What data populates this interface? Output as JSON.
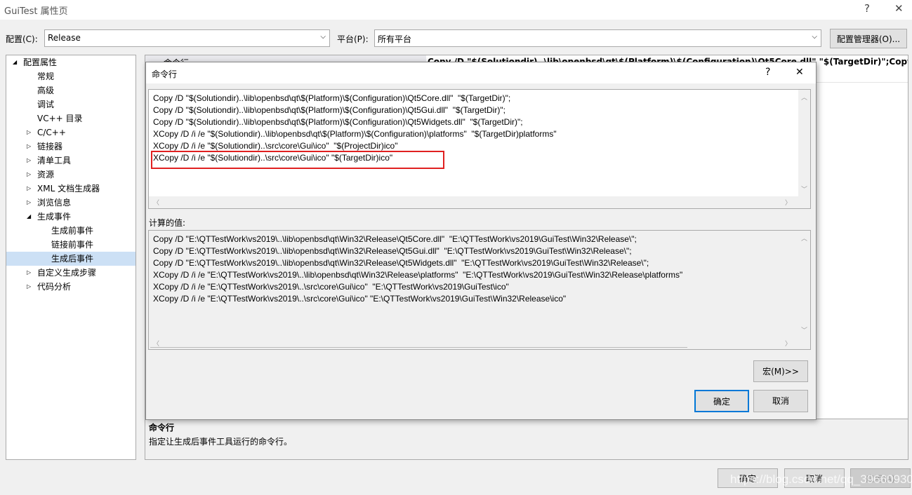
{
  "window": {
    "title": "GuiTest 属性页",
    "help": "?",
    "close": "✕"
  },
  "config": {
    "label": "配置(C):",
    "value": "Release",
    "platform_label": "平台(P):",
    "platform_value": "所有平台",
    "manager": "配置管理器(O)..."
  },
  "tree": [
    {
      "label": "配置属性",
      "level": 0,
      "expander": "◢"
    },
    {
      "label": "常规",
      "level": 1
    },
    {
      "label": "高级",
      "level": 1
    },
    {
      "label": "调试",
      "level": 1
    },
    {
      "label": "VC++ 目录",
      "level": 1
    },
    {
      "label": "C/C++",
      "level": 1,
      "expander": "▷"
    },
    {
      "label": "链接器",
      "level": 1,
      "expander": "▷"
    },
    {
      "label": "清单工具",
      "level": 1,
      "expander": "▷"
    },
    {
      "label": "资源",
      "level": 1,
      "expander": "▷"
    },
    {
      "label": "XML 文档生成器",
      "level": 1,
      "expander": "▷"
    },
    {
      "label": "浏览信息",
      "level": 1,
      "expander": "▷"
    },
    {
      "label": "生成事件",
      "level": 1,
      "expander": "◢"
    },
    {
      "label": "生成前事件",
      "level": 2
    },
    {
      "label": "链接前事件",
      "level": 2
    },
    {
      "label": "生成后事件",
      "level": 2,
      "selected": true
    },
    {
      "label": "自定义生成步骤",
      "level": 1,
      "expander": "▷"
    },
    {
      "label": "代码分析",
      "level": 1,
      "expander": "▷"
    }
  ],
  "property": {
    "name": "命令行",
    "value": "Copy /D \"$(Solutiondir)..\\lib\\openbsd\\qt\\$(Platform)\\$(Configuration)\\Qt5Core.dll\"  \"$(TargetDir)\";Copy /D \"$"
  },
  "description": {
    "title": "命令行",
    "text": "指定让生成后事件工具运行的命令行。"
  },
  "buttons": {
    "ok": "确定",
    "cancel": "取消",
    "apply": "应用(A)"
  },
  "watermark": "https://blog.csdn.net/qq_39660930",
  "dialog": {
    "title": "命令行",
    "help": "?",
    "close": "✕",
    "commands": [
      "Copy /D \"$(Solutiondir)..\\lib\\openbsd\\qt\\$(Platform)\\$(Configuration)\\Qt5Core.dll\"  \"$(TargetDir)\";",
      "Copy /D \"$(Solutiondir)..\\lib\\openbsd\\qt\\$(Platform)\\$(Configuration)\\Qt5Gui.dll\"  \"$(TargetDir)\";",
      "Copy /D \"$(Solutiondir)..\\lib\\openbsd\\qt\\$(Platform)\\$(Configuration)\\Qt5Widgets.dll\"  \"$(TargetDir)\";",
      "XCopy /D /i /e \"$(Solutiondir)..\\lib\\openbsd\\qt\\$(Platform)\\$(Configuration)\\platforms\"  \"$(TargetDir)platforms\"",
      "XCopy /D /i /e \"$(Solutiondir)..\\src\\core\\Gui\\ico\"  \"$(ProjectDir)ico\"",
      "XCopy /D /i /e \"$(Solutiondir)..\\src\\core\\Gui\\ico\" \"$(TargetDir)ico\""
    ],
    "evaluated_label": "计算的值:",
    "evaluated": [
      "Copy /D \"E:\\QTTestWork\\vs2019\\..\\lib\\openbsd\\qt\\Win32\\Release\\Qt5Core.dll\"  \"E:\\QTTestWork\\vs2019\\GuiTest\\Win32\\Release\\\";",
      "Copy /D \"E:\\QTTestWork\\vs2019\\..\\lib\\openbsd\\qt\\Win32\\Release\\Qt5Gui.dll\"  \"E:\\QTTestWork\\vs2019\\GuiTest\\Win32\\Release\\\";",
      "Copy /D \"E:\\QTTestWork\\vs2019\\..\\lib\\openbsd\\qt\\Win32\\Release\\Qt5Widgets.dll\"  \"E:\\QTTestWork\\vs2019\\GuiTest\\Win32\\Release\\\";",
      "XCopy /D /i /e \"E:\\QTTestWork\\vs2019\\..\\lib\\openbsd\\qt\\Win32\\Release\\platforms\"  \"E:\\QTTestWork\\vs2019\\GuiTest\\Win32\\Release\\platforms\"",
      "XCopy /D /i /e \"E:\\QTTestWork\\vs2019\\..\\src\\core\\Gui\\ico\"  \"E:\\QTTestWork\\vs2019\\GuiTest\\ico\"",
      "XCopy /D /i /e \"E:\\QTTestWork\\vs2019\\..\\src\\core\\Gui\\ico\" \"E:\\QTTestWork\\vs2019\\GuiTest\\Win32\\Release\\ico\""
    ],
    "macros": "宏(M)>>",
    "ok": "确定",
    "cancel": "取消"
  }
}
